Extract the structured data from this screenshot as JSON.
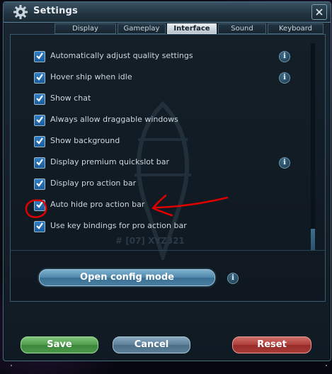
{
  "window": {
    "title": "Settings",
    "tabs": [
      {
        "label": "Display",
        "active": false
      },
      {
        "label": "Gameplay",
        "active": false
      },
      {
        "label": "Interface",
        "active": true
      },
      {
        "label": "Sound",
        "active": false
      },
      {
        "label": "Keyboard",
        "active": false
      }
    ]
  },
  "settings": {
    "items": [
      {
        "label": "Automatically adjust quality settings",
        "checked": true,
        "info": true
      },
      {
        "label": "Hover ship when idle",
        "checked": true,
        "info": true
      },
      {
        "label": "Show chat",
        "checked": true,
        "info": false
      },
      {
        "label": "Always allow draggable windows",
        "checked": true,
        "info": false
      },
      {
        "label": "Show background",
        "checked": true,
        "info": false
      },
      {
        "label": "Display premium quickslot bar",
        "checked": true,
        "info": true
      },
      {
        "label": "Display pro action bar",
        "checked": true,
        "info": false
      },
      {
        "label": "Auto hide pro action bar",
        "checked": true,
        "info": false
      },
      {
        "label": "Use key bindings for pro action bar",
        "checked": true,
        "info": false
      }
    ],
    "background_text": "# [07] XYZ321"
  },
  "config_button": {
    "label": "Open config mode"
  },
  "info_glyph": "i",
  "footer": {
    "save_label": "Save",
    "cancel_label": "Cancel",
    "reset_label": "Reset"
  },
  "colors": {
    "save": "#4d9c4c",
    "cancel": "#5d8099",
    "reset": "#ad3e3a",
    "annotation": "#e00000",
    "checkbox": "#2f7fc8"
  },
  "annotation": {
    "highlight_target": "Auto hide pro action bar"
  }
}
